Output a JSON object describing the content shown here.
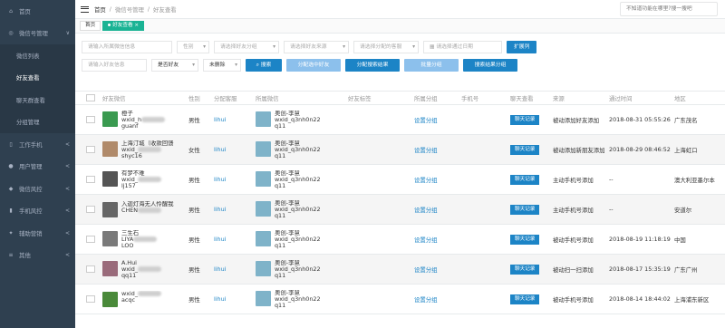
{
  "sidebar": {
    "items": [
      {
        "icon": "home-icon",
        "label": "首页",
        "arrow": ""
      },
      {
        "icon": "wechat-icon",
        "label": "微信号管理",
        "arrow": "∨"
      },
      {
        "icon": "",
        "label": "微信列表",
        "arrow": "",
        "sub": true
      },
      {
        "icon": "",
        "label": "好友查看",
        "arrow": "",
        "sub": true,
        "active": true
      },
      {
        "icon": "",
        "label": "聊天群查看",
        "arrow": "",
        "sub": true
      },
      {
        "icon": "",
        "label": "分组管理",
        "arrow": "",
        "sub": true
      },
      {
        "icon": "phone-icon",
        "label": "工作手机",
        "arrow": "<"
      },
      {
        "icon": "user-icon",
        "label": "用户管理",
        "arrow": "<"
      },
      {
        "icon": "shield-icon",
        "label": "微信风控",
        "arrow": "<"
      },
      {
        "icon": "mobile-icon",
        "label": "手机风控",
        "arrow": "<"
      },
      {
        "icon": "marketing-icon",
        "label": "辅助营销",
        "arrow": "<"
      },
      {
        "icon": "other-icon",
        "label": "其他",
        "arrow": "<"
      }
    ]
  },
  "topbar": {
    "breadcrumb": [
      "首页",
      "/",
      "微信号管理",
      "/",
      "好友查看"
    ],
    "search_placeholder": "不知道功能在哪里?搜一搜吧"
  },
  "tabs": {
    "home": "首页",
    "active": "好友查看",
    "close": "×"
  },
  "filters": {
    "row1": [
      {
        "label": "请输入所属微信信息",
        "w": 100
      },
      {
        "label": "性别",
        "w": 36,
        "sel": true
      },
      {
        "label": "请选择好友分组",
        "w": 72,
        "sel": true
      },
      {
        "label": "请选择好友来源",
        "w": 72,
        "sel": true
      },
      {
        "label": "请选择分配的客服",
        "w": 72,
        "sel": true
      },
      {
        "label": "请选择通过日期",
        "w": 87,
        "cal": true
      }
    ],
    "row1_btn": "扩展列",
    "row2": [
      {
        "label": "请输入好友信息",
        "w": 72
      },
      {
        "label": "是否好友",
        "w": 52,
        "sel": true,
        "dark": true
      },
      {
        "label": "未删除",
        "w": 42,
        "sel": true,
        "dark": true
      }
    ],
    "row2_btns": [
      {
        "label": "搜索",
        "style": "blue",
        "icon": "search-icon"
      },
      {
        "label": "分配选中好友",
        "style": "light"
      },
      {
        "label": "分配搜索结果",
        "style": "blue"
      },
      {
        "label": "批量分组",
        "style": "light"
      },
      {
        "label": "搜索结果分组",
        "style": "blue"
      }
    ]
  },
  "table": {
    "headers": [
      "",
      "好友微信",
      "性别",
      "分配客服",
      "所属微信",
      "好友标签",
      "所属分组",
      "手机号",
      "聊天查看",
      "来源",
      "通过时间",
      "地区"
    ],
    "rows": [
      {
        "friend_name": "橙子",
        "friend_id": "wxid_h",
        "friend_id2": "guanf",
        "gender": "男性",
        "agent": "lihui",
        "owner_name": "奥创-李慧",
        "owner_id": "wxid_",
        "owner_id_tail": "q3nh0n22",
        "owner_id2": "q11",
        "group": "设置分组",
        "chat": "聊天记录",
        "source": "被动添加好友添加",
        "time": "2018-08-31 05:55:26",
        "region": "广东茂名",
        "avatar": "#3a9a50"
      },
      {
        "friend_name": "上海汀城（收款回馈",
        "friend_id": "wxid_",
        "friend_id2": "shyc16",
        "gender": "女性",
        "agent": "lihui",
        "owner_name": "奥创-李慧",
        "owner_id": "wxid_",
        "owner_id_tail": "q3nh0n22",
        "owner_id2": "q11",
        "group": "设置分组",
        "chat": "聊天记录",
        "source": "被动添加新朋友添加",
        "time": "2018-08-29 08:46:52",
        "region": "上海虹口",
        "avatar": "#b08a6a"
      },
      {
        "friend_name": "有梦不难",
        "friend_id": "wxid_",
        "friend_id2": "lj157",
        "gender": "男性",
        "agent": "lihui",
        "owner_name": "奥创-李慧",
        "owner_id": "wxid_",
        "owner_id_tail": "q3nh0n22",
        "owner_id2": "q11",
        "group": "设置分组",
        "chat": "聊天记录",
        "source": "主动手机号添加",
        "time": "--",
        "region": "澳大利亚墨尔本",
        "avatar": "#555"
      },
      {
        "friend_name": "入迦灯海无人怜醒我",
        "friend_id": "CHEN",
        "friend_id2": "",
        "gender": "男性",
        "agent": "lihui",
        "owner_name": "奥创-李慧",
        "owner_id": "wxid_",
        "owner_id_tail": "q3nh0n22",
        "owner_id2": "q11",
        "group": "设置分组",
        "chat": "聊天记录",
        "source": "主动手机号添加",
        "time": "--",
        "region": "安道尔",
        "avatar": "#666"
      },
      {
        "friend_name": "三生石",
        "friend_id": "LIYA",
        "friend_id2": "LOO",
        "gender": "男性",
        "agent": "lihui",
        "owner_name": "奥创-李慧",
        "owner_id": "wxid_",
        "owner_id_tail": "q3nh0n22",
        "owner_id2": "q11",
        "group": "设置分组",
        "chat": "聊天记录",
        "source": "被动手机号添加",
        "time": "2018-08-19 11:18:19",
        "region": "中国",
        "avatar": "#7a7a7a"
      },
      {
        "friend_name": "A.Hui",
        "friend_id": "wxid_",
        "friend_id2": "qq11",
        "gender": "男性",
        "agent": "lihui",
        "owner_name": "奥创-李慧",
        "owner_id": "wxid_",
        "owner_id_tail": "q3nh0n22",
        "owner_id2": "q11",
        "group": "设置分组",
        "chat": "聊天记录",
        "source": "被动扫一扫添加",
        "time": "2018-08-17 15:35:19",
        "region": "广东广州",
        "avatar": "#9a6b7b"
      },
      {
        "friend_name": "",
        "friend_id": "wxid_",
        "friend_id2": "acqc",
        "gender": "男性",
        "agent": "lihui",
        "owner_name": "奥创-李慧",
        "owner_id": "wxid_",
        "owner_id_tail": "q3nh0n22",
        "owner_id2": "q11",
        "group": "设置分组",
        "chat": "聊天记录",
        "source": "被动手机号添加",
        "time": "2018-08-14 18:44:02",
        "region": "上海浦东新区",
        "avatar": "#4a8a3a"
      }
    ]
  }
}
